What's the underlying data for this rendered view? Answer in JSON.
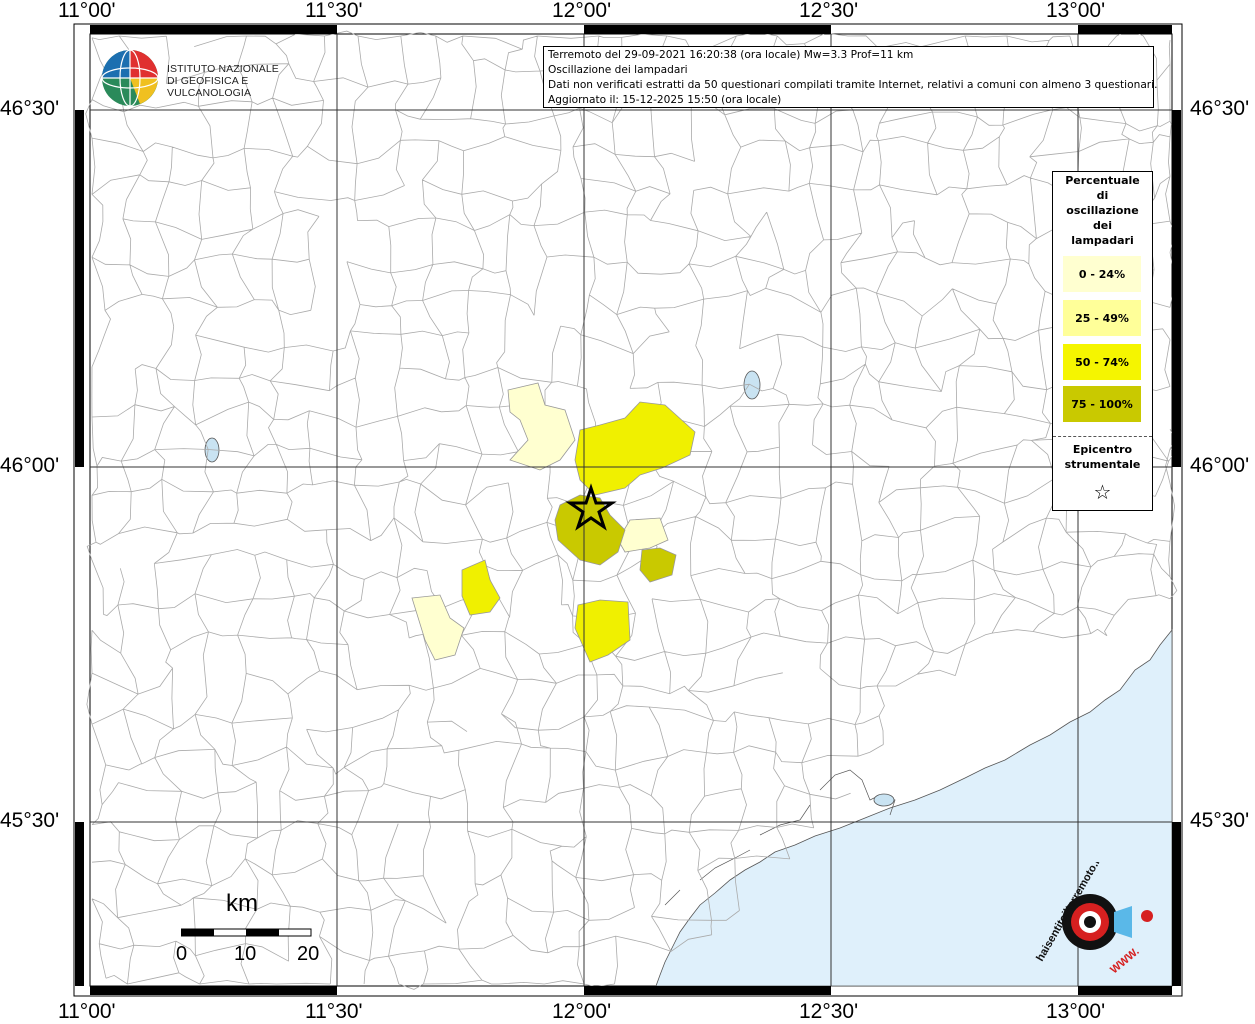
{
  "infobox": {
    "line1": "Terremoto del 29-09-2021 16:20:38 (ora locale) Mw=3.3 Prof=11 km",
    "line2": "Oscillazione dei lampadari",
    "line3": "Dati non verificati estratti da 50 questionari compilati tramite Internet, relativi a comuni con almeno 3 questionari.",
    "line4": "Aggiornato il: 15-12-2025 15:50 (ora locale)"
  },
  "logo": {
    "line1": "ISTITUTO NAZIONALE",
    "line2": "DI GEOFISICA E VULCANOLOGIA"
  },
  "axes": {
    "lon_top": [
      "11°00'",
      "11°30'",
      "12°00'",
      "12°30'",
      "13°00'"
    ],
    "lon_bottom": [
      "11°00'",
      "11°30'",
      "12°00'",
      "12°30'",
      "13°00'"
    ],
    "lat_left": [
      "46°30'",
      "46°00'",
      "45°30'"
    ],
    "lat_right": [
      "46°30'",
      "46°00'",
      "45°30'"
    ]
  },
  "legend": {
    "title_lines": [
      "Percentuale",
      "di",
      "oscillazione",
      "dei",
      "lampadari"
    ],
    "classes": [
      {
        "label": "0 - 24%",
        "color": "#ffffd0"
      },
      {
        "label": "25 - 49%",
        "color": "#ffff99"
      },
      {
        "label": "50 - 74%",
        "color": "#f5f500"
      },
      {
        "label": "75 - 100%",
        "color": "#c9c900"
      }
    ],
    "epicenter_lines": [
      "Epicentro",
      "strumentale"
    ],
    "epicenter_symbol": "☆"
  },
  "scalebar": {
    "unit": "km",
    "labels": [
      "0",
      "10",
      "20"
    ]
  },
  "colors": {
    "sea": "#dff0fb",
    "lake": "#c9e3f2",
    "boundary": "#aaaaaa",
    "grid": "#333333",
    "frame": "#000000"
  },
  "hst_logo": {
    "text": "haisentitoilterremoto.it",
    "url": "WWW."
  }
}
